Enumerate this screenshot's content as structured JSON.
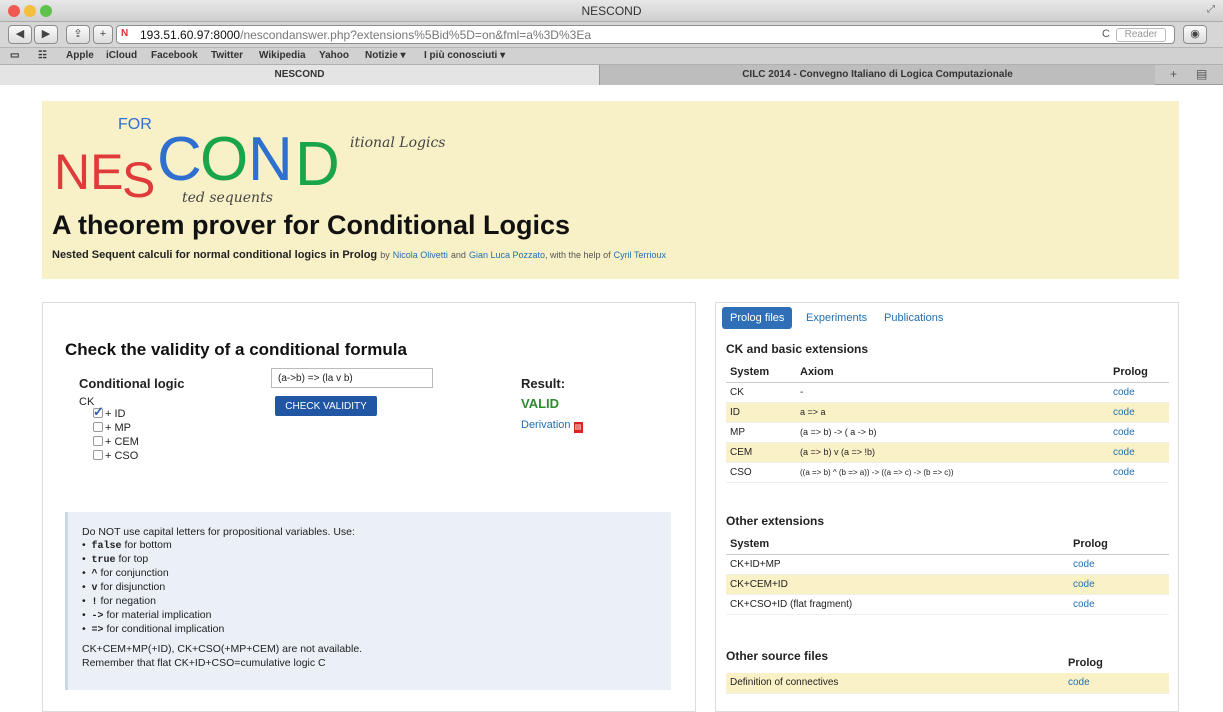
{
  "window": {
    "title": "NESCOND"
  },
  "toolbar": {
    "back": "◀",
    "forward": "▶",
    "share": "⇪",
    "add": "+",
    "url_host": "193.51.60.97:8000",
    "url_path": "/nescondanswer.php?extensions%5Bid%5D=on&fml=a%3D%3Ea",
    "reader": "Reader",
    "reload": "C"
  },
  "bookmarks": [
    "Apple",
    "iCloud",
    "Facebook",
    "Twitter",
    "Wikipedia",
    "Yahoo",
    "Notizie ▾",
    "I più conosciuti ▾"
  ],
  "tabs": {
    "active": "NESCOND",
    "other": "CILC 2014 - Convegno Italiano di Logica Computazionale"
  },
  "header": {
    "logo": {
      "for": "FOR",
      "ne": "NE",
      "s": "S",
      "c": "C",
      "o": "O",
      "n": "N",
      "d": "D",
      "tail1": "itional Logics",
      "tail2": "ted sequents"
    },
    "title": "A theorem prover for Conditional Logics",
    "subtitle_bold": "Nested Sequent calculi for normal conditional logics in Prolog",
    "by": "by",
    "author1": "Nicola Olivetti",
    "and": "and",
    "author2": "Gian Luca Pozzato",
    "help": ", with the help of",
    "author3": "Cyril Terrioux"
  },
  "check": {
    "heading": "Check the validity of a conditional formula",
    "logic_label": "Conditional logic",
    "base": "CK",
    "extensions": [
      {
        "label": "+ ID",
        "checked": true
      },
      {
        "label": "+ MP",
        "checked": false
      },
      {
        "label": "+ CEM",
        "checked": false
      },
      {
        "label": "+ CSO",
        "checked": false
      }
    ],
    "formula": "(a->b) => (la v b)",
    "button": "CHECK VALIDITY",
    "result_label": "Result:",
    "result": "VALID",
    "derivation": "Derivation"
  },
  "info": {
    "intro": "Do NOT use capital letters for propositional variables. Use:",
    "items": [
      {
        "code": "false",
        "text": " for bottom"
      },
      {
        "code": "true",
        "text": " for top"
      },
      {
        "code": "^",
        "text": " for conjunction"
      },
      {
        "code": "v",
        "text": " for disjunction"
      },
      {
        "code": "!",
        "text": " for negation"
      },
      {
        "code": "->",
        "text": " for material implication"
      },
      {
        "code": "=>",
        "text": " for conditional implication"
      }
    ],
    "note1": "CK+CEM+MP(+ID), CK+CSO(+MP+CEM) are not available.",
    "note2": "Remember that flat CK+ID+CSO=cumulative logic C"
  },
  "right": {
    "tabs": [
      "Prolog files",
      "Experiments",
      "Publications"
    ],
    "basic": {
      "title": "CK and basic extensions",
      "headers": [
        "System",
        "Axiom",
        "Prolog"
      ],
      "rows": [
        {
          "system": "CK",
          "axiom": "-",
          "prolog": "code"
        },
        {
          "system": "ID",
          "axiom": "a => a",
          "prolog": "code"
        },
        {
          "system": "MP",
          "axiom": "(a => b) -> ( a -> b)",
          "prolog": "code"
        },
        {
          "system": "CEM",
          "axiom": "(a => b) v (a => !b)",
          "prolog": "code"
        },
        {
          "system": "CSO",
          "axiom": "((a => b) ^ (b => a)) -> ((a => c) -> (b => c))",
          "prolog": "code"
        }
      ]
    },
    "other": {
      "title": "Other extensions",
      "headers": [
        "System",
        "Prolog"
      ],
      "rows": [
        {
          "system": "CK+ID+MP",
          "prolog": "code"
        },
        {
          "system": "CK+CEM+ID",
          "prolog": "code"
        },
        {
          "system": "CK+CSO+ID (flat fragment)",
          "prolog": "code"
        }
      ]
    },
    "source": {
      "title": "Other source files",
      "header": "Prolog",
      "rows": [
        {
          "name": "Definition of connectives",
          "prolog": "code"
        }
      ]
    }
  },
  "colors": {
    "logo_red": "#e03a3a",
    "logo_green": "#1aa54a",
    "logo_blue": "#2f6fd0",
    "header_bg": "#f8f1c8",
    "button": "#2156a5",
    "valid": "#2e8b2e"
  }
}
